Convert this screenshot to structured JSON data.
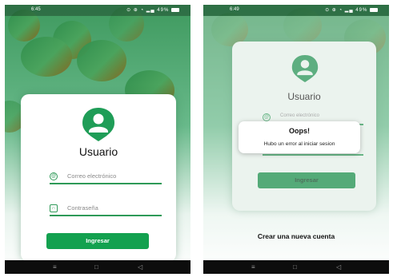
{
  "left_screen": {
    "status_time": "6:45",
    "status_icons": "⊙ ⊕ ◔ ▂▄ 49%",
    "title": "Usuario",
    "email_placeholder": "Correo electrónico",
    "password_placeholder": "Contraseña",
    "login_button": "Ingresar"
  },
  "right_screen": {
    "status_time": "6:49",
    "status_icons": "⊙ ⊕ ◔ ▂▄ 49%",
    "title": "Usuario",
    "email_placeholder": "Correo electrónico",
    "password_placeholder": "••••••",
    "login_button": "Ingresar",
    "alert_title": "Oops!",
    "alert_message": "Hubo un error al iniciar sesion",
    "create_account_link": "Crear una nueva cuenta"
  },
  "navbar": {
    "menu": "≡",
    "home": "□",
    "back": "◁"
  },
  "icons": [
    "user-pin-icon",
    "at-icon",
    "lock-icon",
    "battery-icon"
  ],
  "colors": {
    "brand_green": "#13a14f",
    "accent_line": "#2e9a58",
    "navbar": "#0d0d0d"
  }
}
